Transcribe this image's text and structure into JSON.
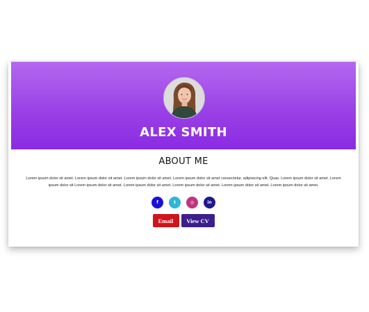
{
  "profile": {
    "name": "ALEX SMITH",
    "avatar_icon": "person-portrait-icon"
  },
  "about": {
    "title": "ABOUT ME",
    "text": "Lorem ipsum dolor sit amet. Lorem ipsum dolor sit amet. Lorem ipsum dolor sit amet. Lorem ipsum dolor sit amet consectetur, adipisicing elit. Quas. Lorem ipsum dolor sit amet. Lorem ipsum dolor sit Lorem ipsum dolor sit amet. Lorem ipsum dolor sit amet. Lorem ipsum dolor sit amet. Lorem ipsum dolor sit amet. Lorem ipsum dolor sit amet."
  },
  "social": [
    {
      "label": "f",
      "icon": "facebook-icon",
      "color": "#1a11d8"
    },
    {
      "label": "t",
      "icon": "twitter-icon",
      "color": "#2fb5d9"
    },
    {
      "label": "◎",
      "icon": "instagram-icon",
      "color": "#c0357e"
    },
    {
      "label": "in",
      "icon": "linkedin-icon",
      "color": "#20188f"
    }
  ],
  "buttons": {
    "email_label": "Email",
    "cv_label": "View CV"
  },
  "colors": {
    "banner_top": "#b468ef",
    "banner_bottom": "#8a2be2",
    "email_button": "#d0141b",
    "cv_button": "#3d1f8c"
  }
}
